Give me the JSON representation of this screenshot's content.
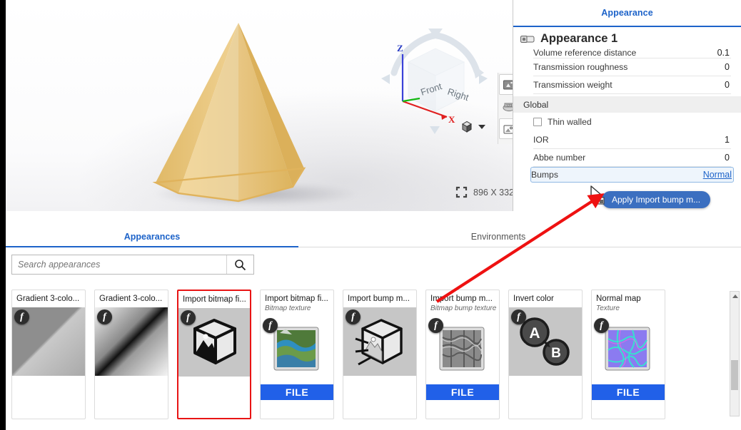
{
  "viewport": {
    "name": "3d-viewport",
    "model": "hexagonal-pyramid",
    "model_color": "#edc97a",
    "navcube": {
      "front_label": "Front",
      "right_label": "Right",
      "axis_z": "Z",
      "axis_x": "X"
    },
    "resolution_label": "896 X 332",
    "toolbar_icons": [
      "render-image-icon",
      "render-settings-icon",
      "save-image-icon"
    ],
    "display_style_icon": "shaded-cube-icon"
  },
  "properties_panel": {
    "tab_label": "Appearance",
    "title": "Appearance 1",
    "title_icon": "appearance-swatch-icon",
    "rows_top": [
      {
        "label": "Volume reference distance",
        "value": "0.1"
      },
      {
        "label": "Transmission roughness",
        "value": "0"
      },
      {
        "label": "Transmission weight",
        "value": "0"
      }
    ],
    "section_label": "Global",
    "checkbox": {
      "label": "Thin walled",
      "checked": false
    },
    "rows_global": [
      {
        "label": "IOR",
        "value": "1"
      },
      {
        "label": "Abbe number",
        "value": "0"
      }
    ],
    "drop_row": {
      "label": "Bumps",
      "value": "Normal"
    },
    "collapse_icon": "chevron-down-icon"
  },
  "drag": {
    "tooltip": "Apply Import bump m...",
    "cursor_icon": "drag-drop-cursor"
  },
  "library": {
    "tabs": [
      {
        "label": "Appearances",
        "active": true
      },
      {
        "label": "Environments",
        "active": false
      }
    ],
    "search": {
      "placeholder": "Search appearances",
      "value": "",
      "icon": "search-icon"
    },
    "cards": [
      {
        "title": "Gradient 3-colo...",
        "subtitle": "",
        "thumb": "gradient-3-color-a",
        "file": false,
        "selected": false,
        "fx": true
      },
      {
        "title": "Gradient 3-colo...",
        "subtitle": "",
        "thumb": "gradient-3-color-b",
        "file": false,
        "selected": false,
        "fx": true
      },
      {
        "title": "Import bitmap fi...",
        "subtitle": "",
        "thumb": "bitmap-cube",
        "file": false,
        "selected": true,
        "fx": true
      },
      {
        "title": "Import bitmap fi...",
        "subtitle": "Bitmap texture",
        "thumb": "landscape-swatch",
        "file": true,
        "file_label": "FILE",
        "selected": false,
        "fx": true
      },
      {
        "title": "Import bump m...",
        "subtitle": "",
        "thumb": "bump-cube",
        "file": false,
        "selected": false,
        "fx": true
      },
      {
        "title": "Import bump m...",
        "subtitle": "Bitmap bump texture",
        "thumb": "rock-bump-swatch",
        "file": true,
        "file_label": "FILE",
        "selected": false,
        "fx": true
      },
      {
        "title": "Invert color",
        "subtitle": "",
        "thumb": "invert-a-b",
        "file": false,
        "selected": false,
        "fx": true,
        "node_a": "A",
        "node_b": "B"
      },
      {
        "title": "Normal map",
        "subtitle": "Texture",
        "thumb": "normal-map-swatch",
        "file": true,
        "file_label": "FILE",
        "selected": false,
        "fx": true
      }
    ],
    "scrollbar": {
      "icon": "scroll-up-arrow-icon"
    }
  },
  "annotation": {
    "arrow_color": "#ee1111",
    "selection_box_color": "#e81414"
  }
}
